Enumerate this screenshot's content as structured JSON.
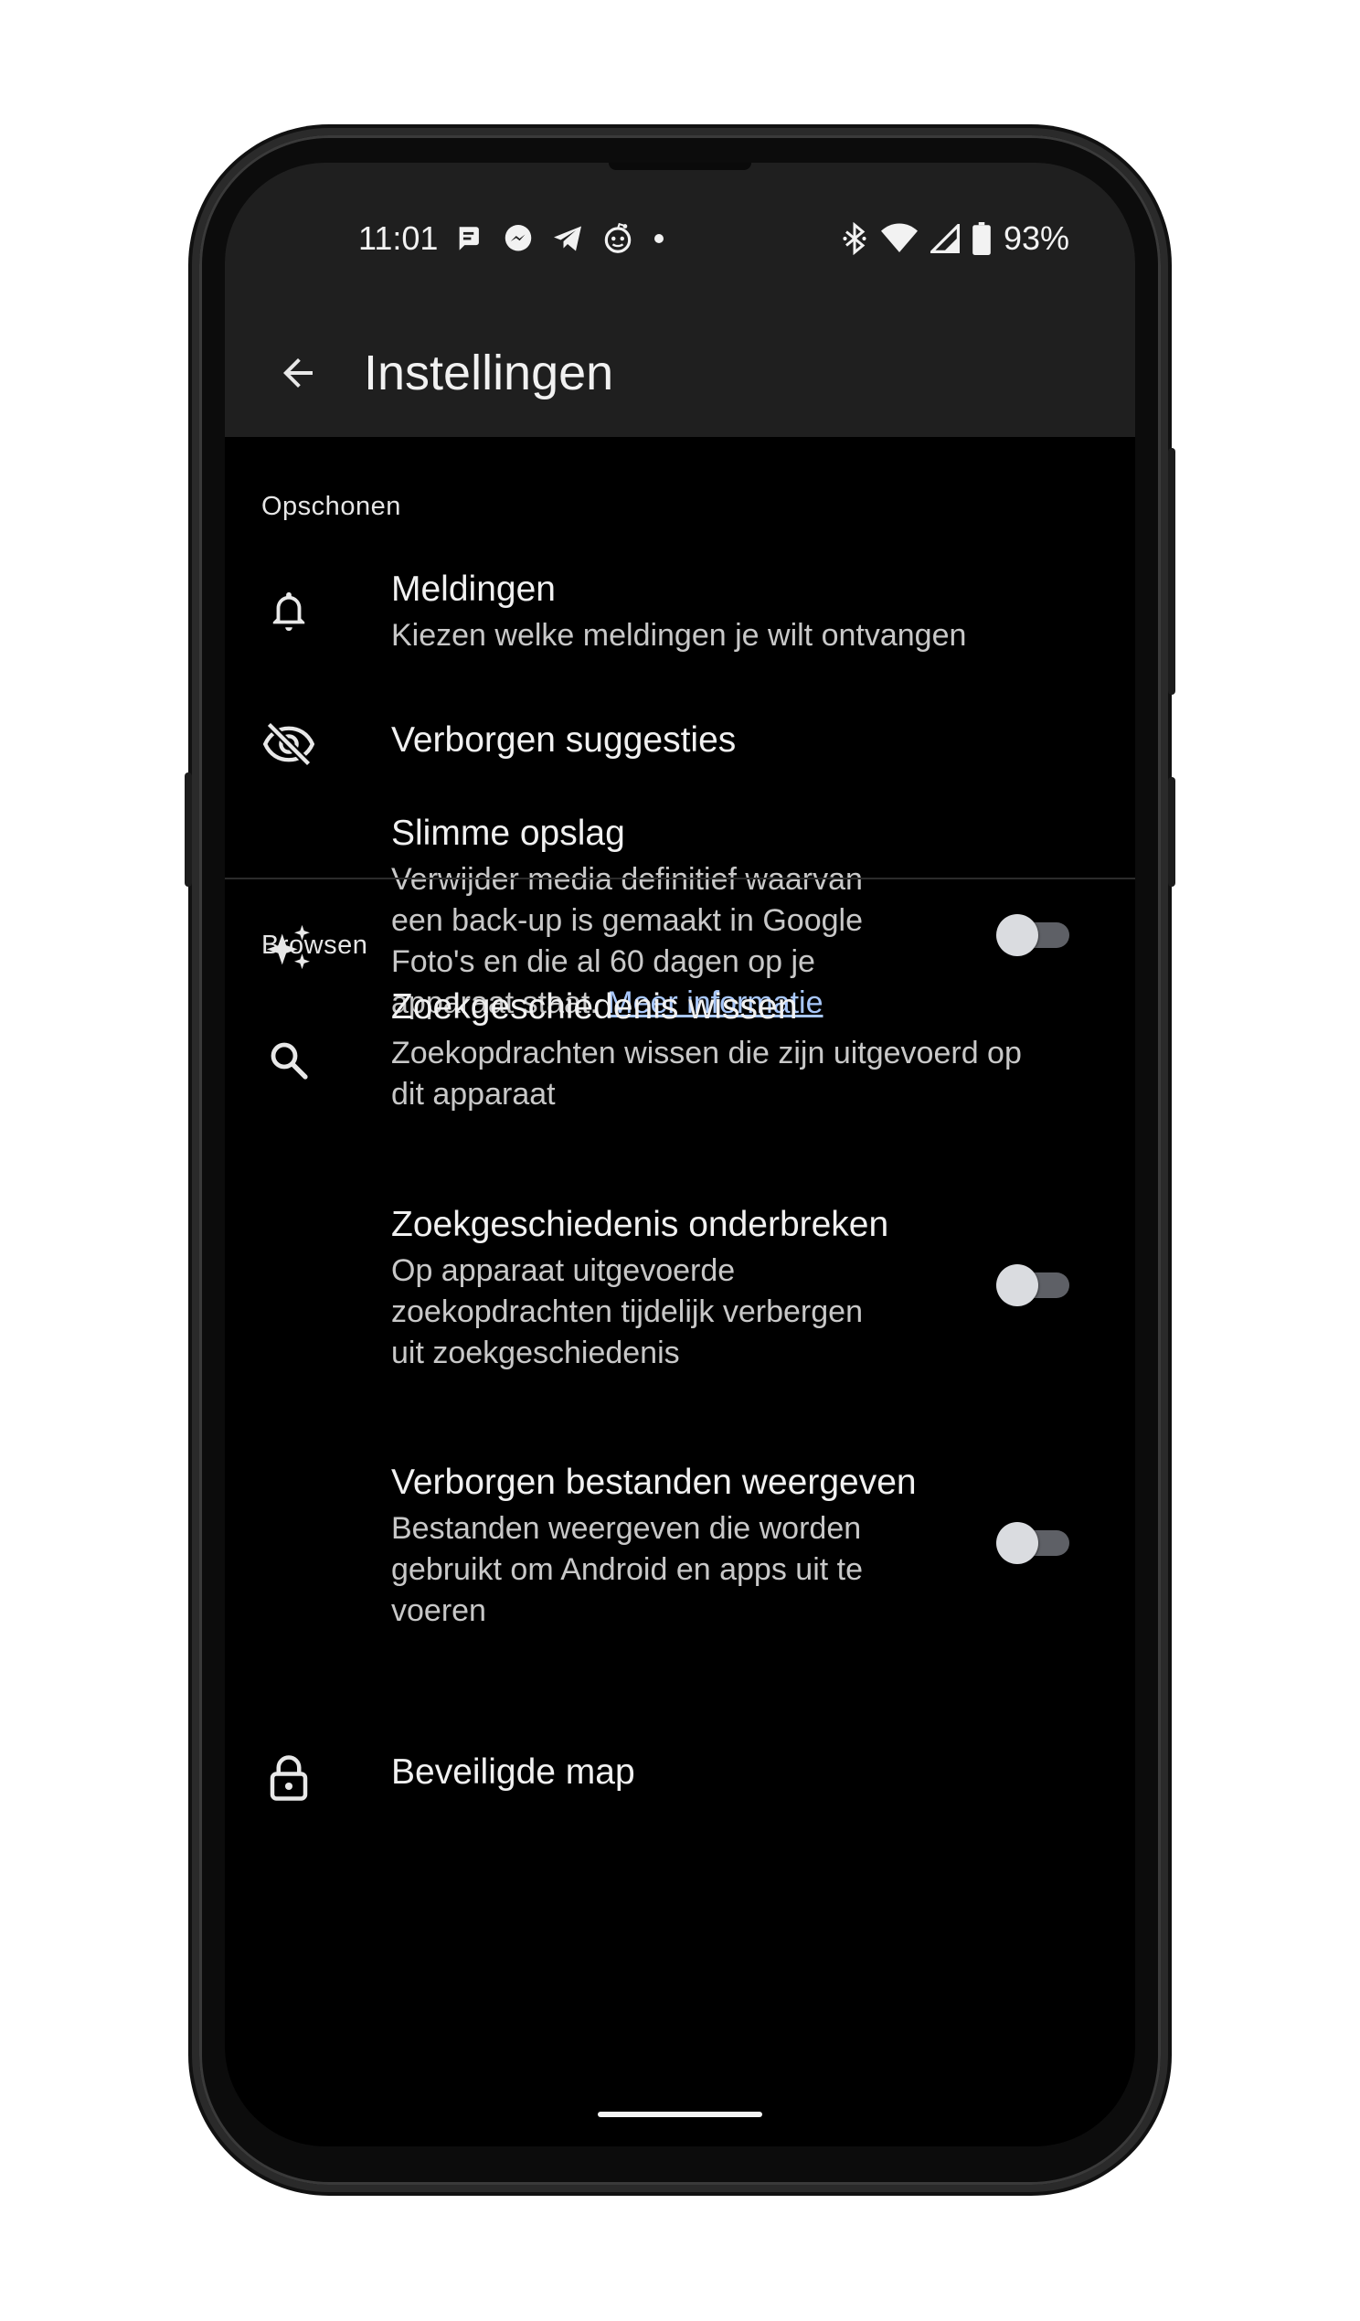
{
  "status_bar": {
    "time": "11:01",
    "battery": "93%",
    "notification_icons": [
      "message-icon",
      "messenger-icon",
      "telegram-icon",
      "reddit-icon",
      "more-dot-icon"
    ],
    "system_icons": [
      "bluetooth-icon",
      "wifi-icon",
      "cell-signal-icon",
      "battery-icon"
    ]
  },
  "app_bar": {
    "title": "Instellingen",
    "back_icon": "arrow-back-icon"
  },
  "sections": {
    "cleanup": {
      "header": "Opschonen",
      "notifications": {
        "title": "Meldingen",
        "summary": "Kiezen welke meldingen je wilt ontvangen",
        "icon": "bell-icon"
      },
      "hidden_suggestions": {
        "title": "Verborgen suggesties",
        "icon": "eye-off-icon"
      },
      "smart_storage": {
        "title": "Slimme opslag",
        "summary_line1": "Verwijder media definitief waarvan",
        "summary_line2": "een back-up is gemaakt in Google",
        "summary_line3": "Foto's en die al 60 dagen op je",
        "summary_line4": "apparaat staat.",
        "link": "Meer informatie",
        "icon": "sparkle-icon",
        "enabled": false
      }
    },
    "browse": {
      "header": "Browsen",
      "clear_history": {
        "title": "Zoekgeschiedenis wissen",
        "summary_line1": "Zoekopdrachten wissen die zijn uitgevoerd op",
        "summary_line2": "dit apparaat",
        "icon": "search-icon"
      },
      "pause_history": {
        "title": "Zoekgeschiedenis onderbreken",
        "summary_line1": "Op apparaat uitgevoerde",
        "summary_line2": "zoekopdrachten tijdelijk verbergen",
        "summary_line3": "uit zoekgeschiedenis",
        "enabled": false
      },
      "show_hidden": {
        "title": "Verborgen bestanden weergeven",
        "summary_line1": "Bestanden weergeven die worden",
        "summary_line2": "gebruikt om Android en apps uit te",
        "summary_line3": "voeren",
        "enabled": false
      },
      "safe_folder": {
        "title": "Beveiligde map",
        "icon": "lock-icon"
      }
    }
  },
  "colors": {
    "background": "#000000",
    "app_bar": "#1f1f1f",
    "text_primary": "#f1f1f1",
    "text_secondary": "#c8c8c8",
    "link": "#a8c7fa",
    "toggle_track": "#5e6066",
    "toggle_thumb": "#dadce0"
  }
}
